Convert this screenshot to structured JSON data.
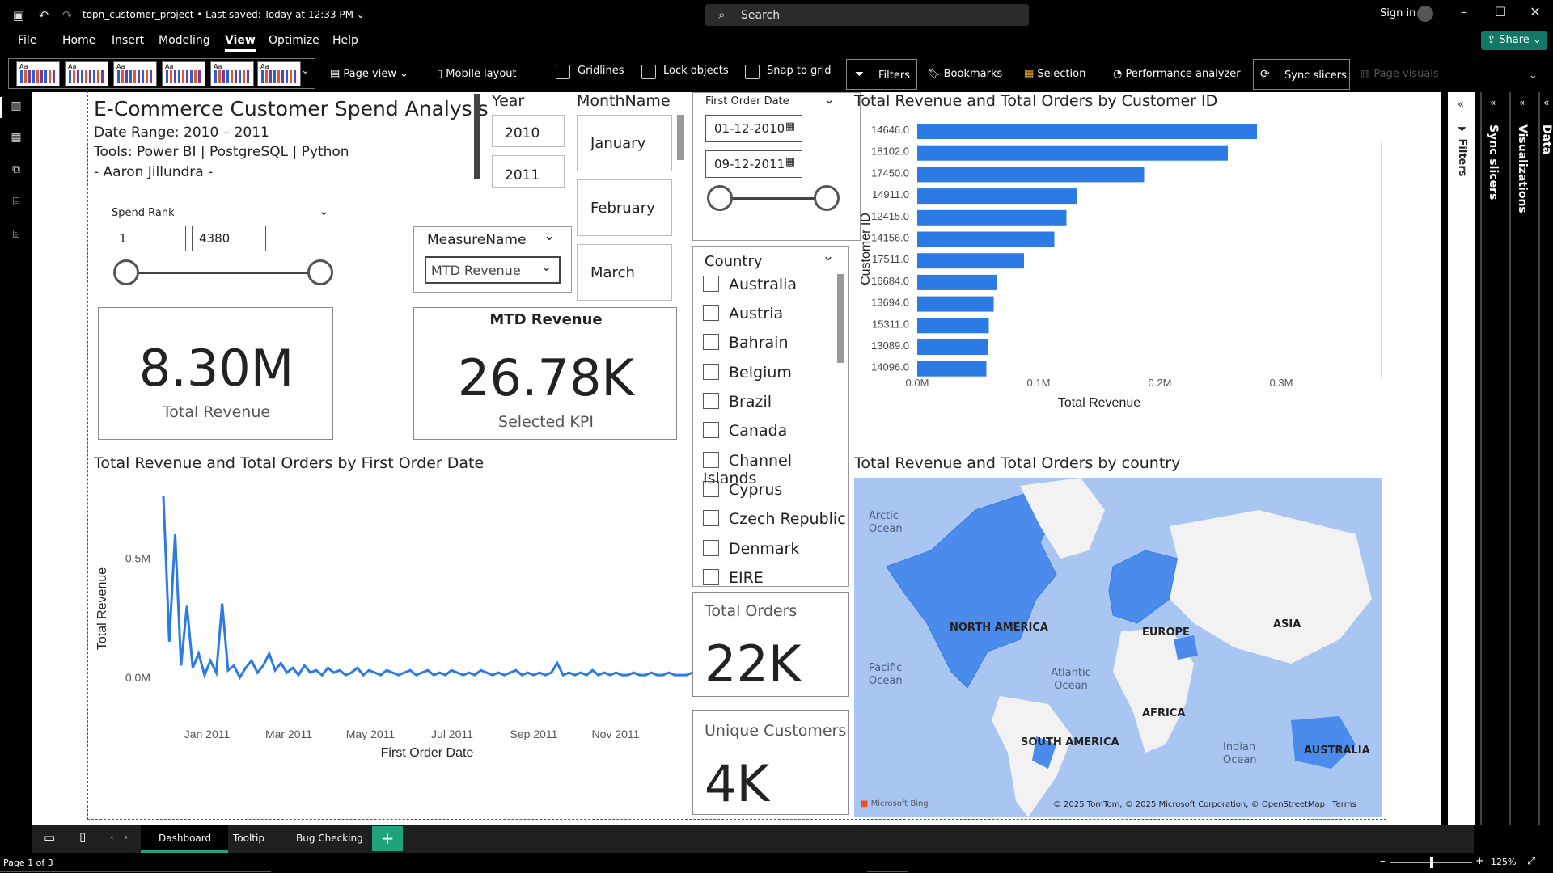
{
  "app": {
    "file_title": "topn_customer_project",
    "save_status": "Last saved: Today at 12:33 PM",
    "search_placeholder": "Search",
    "sign_in": "Sign in",
    "share": "Share"
  },
  "menu": [
    "File",
    "Home",
    "Insert",
    "Modeling",
    "View",
    "Optimize",
    "Help"
  ],
  "menu_active": "View",
  "ribbon": {
    "page_view": "Page view",
    "mobile_layout": "Mobile layout",
    "gridlines": "Gridlines",
    "lock_objects": "Lock objects",
    "snap_to_grid": "Snap to grid",
    "filters": "Filters",
    "bookmarks": "Bookmarks",
    "selection": "Selection",
    "performance_analyzer": "Performance analyzer",
    "sync_slicers": "Sync slicers",
    "page_visuals": "Page visuals",
    "theme_label": "Aa"
  },
  "panes": {
    "filters": "Filters",
    "sync_slicers": "Sync slicers",
    "visualizations": "Visualizations",
    "data": "Data"
  },
  "report": {
    "title": "E-Commerce Customer Spend Analysis",
    "date_range": "Date Range: 2010 – 2011",
    "tools": "Tools: Power BI | PostgreSQL | Python",
    "author": "- Aaron Jillundra -",
    "year_slicer": {
      "title": "Year",
      "items": [
        "2010",
        "2011"
      ]
    },
    "month_slicer": {
      "title": "MonthName",
      "items": [
        "January",
        "February",
        "March"
      ]
    },
    "date_slicer": {
      "title": "First Order Date",
      "start": "01-12-2010",
      "end": "09-12-2011"
    },
    "spend_rank": {
      "title": "Spend Rank",
      "min": "1",
      "max": "4380"
    },
    "measure_slicer": {
      "title": "MeasureName",
      "selected": "MTD Revenue"
    },
    "country_slicer": {
      "title": "Country",
      "items": [
        "Australia",
        "Austria",
        "Bahrain",
        "Belgium",
        "Brazil",
        "Canada",
        "Channel Islands",
        "Cyprus",
        "Czech Republic",
        "Denmark",
        "EIRE"
      ]
    },
    "kpi_total_revenue": {
      "value": "8.30M",
      "label": "Total Revenue"
    },
    "kpi_selected": {
      "title": "MTD Revenue",
      "value": "26.78K",
      "label": "Selected KPI"
    },
    "kpi_total_orders": {
      "label": "Total Orders",
      "value": "22K"
    },
    "kpi_unique_customers": {
      "label": "Unique Customers",
      "value": "4K"
    },
    "map": {
      "title": "Total Revenue and Total Orders by country",
      "labels": {
        "arctic": "Arctic Ocean",
        "na": "NORTH AMERICA",
        "europe": "EUROPE",
        "asia": "ASIA",
        "pacific": "Pacific Ocean",
        "atlantic": "Atlantic Ocean",
        "africa": "AFRICA",
        "sa": "SOUTH AMERICA",
        "indian": "Indian Ocean",
        "australia": "AUSTRALIA"
      },
      "credit": "© 2025 TomTom, © 2025 Microsoft Corporation,",
      "osm": "© OpenStreetMap",
      "terms": "Terms",
      "bing": "Microsoft Bing"
    }
  },
  "chart_data": [
    {
      "type": "bar",
      "orientation": "horizontal",
      "title": "Total Revenue and Total Orders by Customer ID",
      "xlabel": "Total Revenue",
      "ylabel": "Customer ID",
      "categories": [
        "14646.0",
        "18102.0",
        "17450.0",
        "14911.0",
        "12415.0",
        "14156.0",
        "17511.0",
        "16684.0",
        "13694.0",
        "15311.0",
        "13089.0",
        "14096.0"
      ],
      "values": [
        280000,
        256000,
        187000,
        132000,
        123000,
        113000,
        88000,
        66000,
        63000,
        59000,
        58000,
        57000
      ],
      "xlim": [
        0,
        300000
      ],
      "xticks": [
        "0.0M",
        "0.1M",
        "0.2M",
        "0.3M"
      ],
      "color": "#2c7be5"
    },
    {
      "type": "line",
      "title": "Total Revenue and Total Orders by First Order Date",
      "xlabel": "First Order Date",
      "ylabel": "Total Revenue",
      "x_range": [
        "2010-12-01",
        "2011-12-09"
      ],
      "xticks": [
        "Jan 2011",
        "Mar 2011",
        "May 2011",
        "Jul 2011",
        "Sep 2011",
        "Nov 2011"
      ],
      "yticks": [
        "0.0M",
        "0.5M"
      ],
      "ylim": [
        0,
        0.78
      ],
      "y_units": "M",
      "values": [
        0.76,
        0.15,
        0.6,
        0.05,
        0.3,
        0.04,
        0.1,
        0.01,
        0.07,
        0.02,
        0.31,
        0.03,
        0.05,
        0.0,
        0.04,
        0.07,
        0.02,
        0.05,
        0.1,
        0.03,
        0.06,
        0.02,
        0.04,
        0.01,
        0.05,
        0.02,
        0.03,
        0.01,
        0.04,
        0.02,
        0.03,
        0.01,
        0.02,
        0.04,
        0.01,
        0.03,
        0.02,
        0.01,
        0.03,
        0.02,
        0.01,
        0.02,
        0.03,
        0.01,
        0.02,
        0.03,
        0.01,
        0.02,
        0.01,
        0.03,
        0.02,
        0.01,
        0.02,
        0.01,
        0.03,
        0.02,
        0.01,
        0.02,
        0.01,
        0.02,
        0.03,
        0.01,
        0.02,
        0.01,
        0.02,
        0.01,
        0.02,
        0.06,
        0.01,
        0.02,
        0.01,
        0.02,
        0.01,
        0.03,
        0.01,
        0.02,
        0.01,
        0.02,
        0.01,
        0.01,
        0.02,
        0.01,
        0.01,
        0.02,
        0.01,
        0.01,
        0.02,
        0.01,
        0.01,
        0.01,
        0.02
      ],
      "color": "#2c7be5"
    }
  ],
  "page_tabs": [
    "Dashboard",
    "Tooltip",
    "Bug Checking"
  ],
  "page_tab_active": "Dashboard",
  "status": {
    "page": "Page 1 of 3",
    "zoom": "125%"
  }
}
